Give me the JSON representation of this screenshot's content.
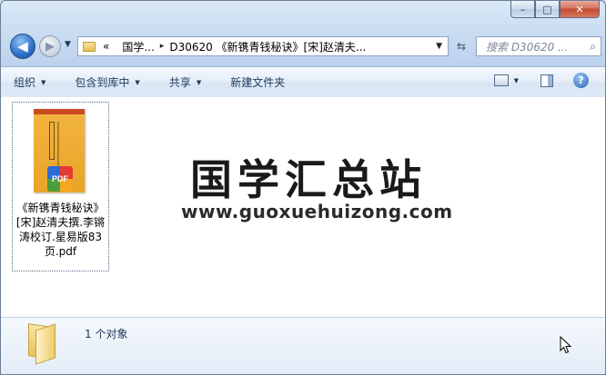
{
  "window": {
    "caption_minimize": "–",
    "caption_maximize": "□",
    "caption_close": "✕"
  },
  "nav": {
    "back_glyph": "◀",
    "forward_glyph": "▶",
    "history_glyph": "▼"
  },
  "address": {
    "overflow": "«",
    "crumbs": [
      "国学...",
      "D30620 《新镌青钱秘诀》[宋]赵清夫..."
    ],
    "separator": "▸",
    "dropdown": "▼"
  },
  "refresh_glyph": "⇆",
  "search": {
    "placeholder": "搜索 D30620 ...",
    "icon_glyph": "⌕"
  },
  "toolbar": {
    "organize": "组织",
    "include_library": "包含到库中",
    "share": "共享",
    "new_folder": "新建文件夹",
    "dropdown_glyph": "▼",
    "help_glyph": "?"
  },
  "file": {
    "name": "《新镌青钱秘诀》[宋]赵清夫撰.李锵涛校订.星易版83页.pdf",
    "badge": "PDF"
  },
  "watermark": {
    "title": "国学汇总站",
    "url": "www.guoxuehuizong.com"
  },
  "status": {
    "count": "1 个对象"
  }
}
